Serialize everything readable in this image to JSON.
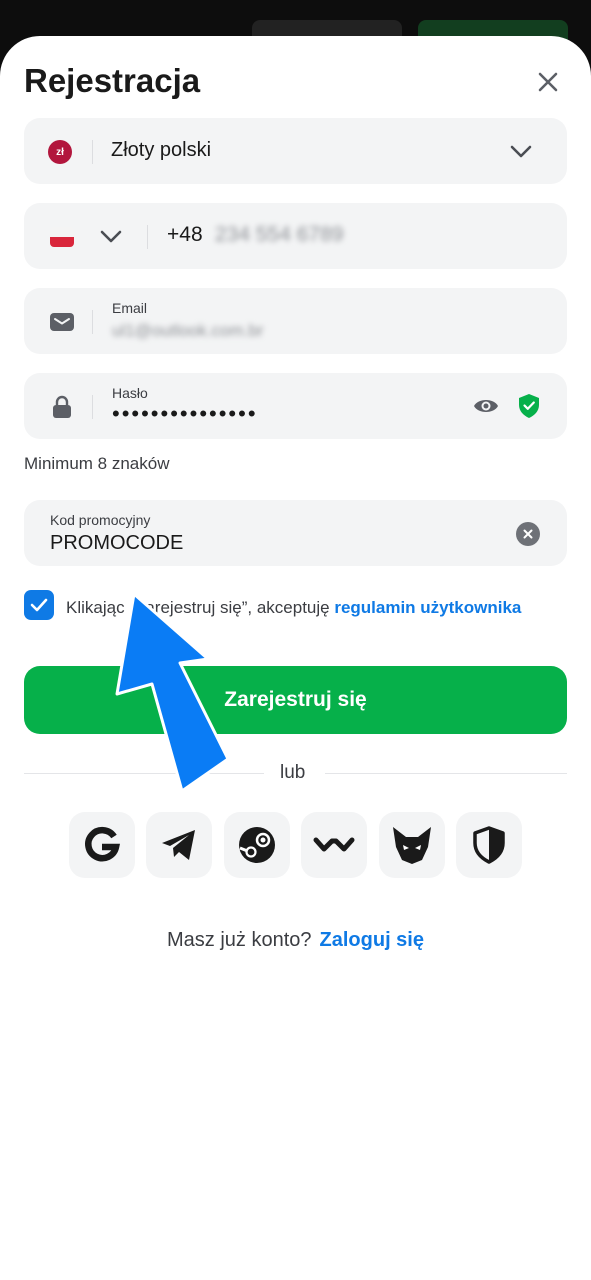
{
  "modal": {
    "title": "Rejestracja"
  },
  "currency": {
    "badge": "zł",
    "value": "Złoty polski"
  },
  "phone": {
    "prefix": "+48",
    "number": "234 554 6789"
  },
  "email": {
    "label": "Email",
    "value": "ul1@outlook.com.br"
  },
  "password": {
    "label": "Hasło",
    "masked": "•••••••••••••••",
    "hint": "Minimum 8 znaków"
  },
  "promo": {
    "label": "Kod promocyjny",
    "value": "PROMOCODE"
  },
  "terms": {
    "checked": true,
    "text_before": "Klikając „Zarejestruj się”, akceptuję ",
    "link": "regulamin użytkownika"
  },
  "submit_label": "Zarejestruj się",
  "divider_text": "lub",
  "social": [
    {
      "icon": "google-icon"
    },
    {
      "icon": "telegram-icon"
    },
    {
      "icon": "steam-icon"
    },
    {
      "icon": "walletconnect-icon"
    },
    {
      "icon": "metamask-icon"
    },
    {
      "icon": "shield-icon"
    }
  ],
  "login": {
    "question": "Masz już konto?",
    "link": "Zaloguj się"
  },
  "colors": {
    "accent_green": "#06b04a",
    "accent_blue": "#0f7ae5",
    "field_bg": "#f3f4f5",
    "arrow_blue": "#0a7cf5"
  }
}
